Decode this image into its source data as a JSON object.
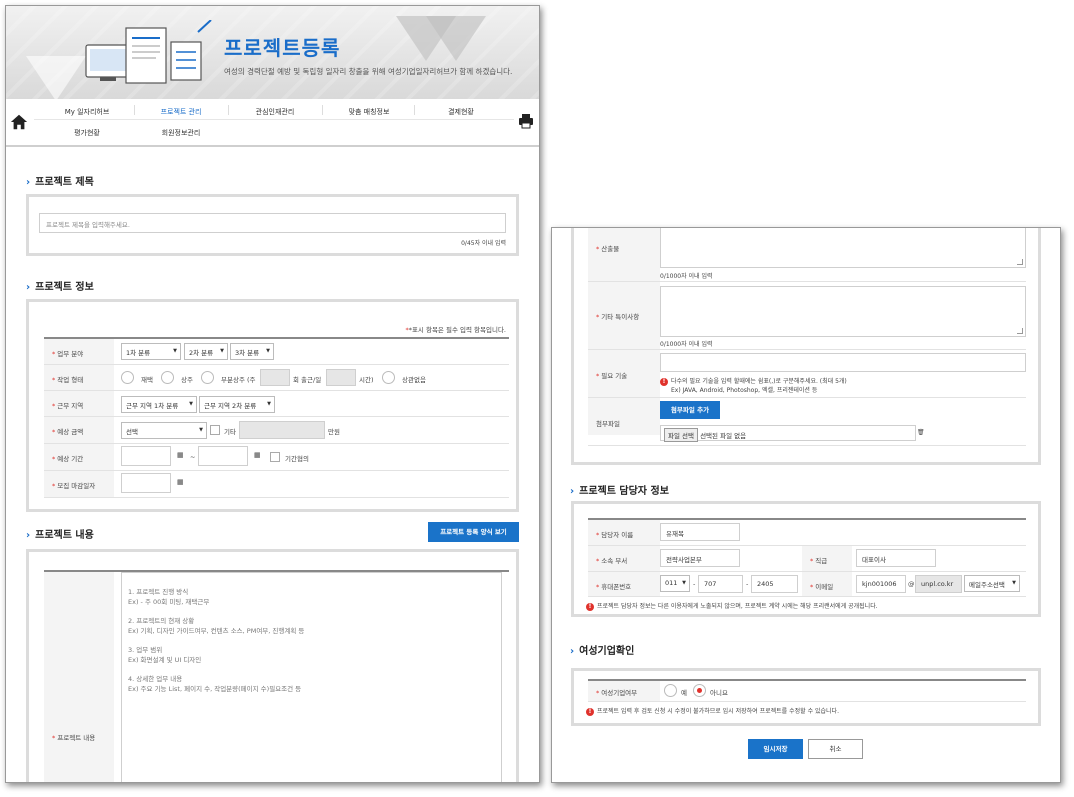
{
  "banner": {
    "title": "프로젝트등록",
    "subtitle": "여성의 경력단절 예방 및 독립형 일자리 창출을 위해 여성기업일자리허브가 함께 하겠습니다."
  },
  "nav": {
    "row1": [
      "My 일자리허브",
      "프로젝트 관리",
      "관심인재관리",
      "맞춤 매칭정보",
      "결제현황"
    ],
    "row2": [
      "평가현황",
      "회원정보관리"
    ],
    "active": "프로젝트 관리"
  },
  "title_section": {
    "heading": "프로젝트 제목",
    "placeholder": "프로젝트 제목을 입력해주세요.",
    "counter": "0/45자 이내 입력"
  },
  "info_section": {
    "heading": "프로젝트 정보",
    "required_note": "*표시 항목은 필수 입력 항목입니다.",
    "fields": {
      "category": {
        "label": "업무 분야",
        "sel1": "1차 분류",
        "sel2": "2차 분류",
        "sel3": "3차 분류"
      },
      "work_type": {
        "label": "작업 형태",
        "opt1": "재택",
        "opt2": "상주",
        "opt3": "부분상주 (주",
        "unit1": "회 출근/일",
        "unit2": "시간)",
        "opt4": "상관없음"
      },
      "region": {
        "label": "근무 지역",
        "sel1": "근무 지역 1차 분류",
        "sel2": "근무 지역 2차 분류"
      },
      "amount": {
        "label": "예상 금액",
        "sel": "선택",
        "etc": "기타",
        "unit": "만원"
      },
      "period": {
        "label": "예상 기간",
        "tilde": "~",
        "nego": "기간협의"
      },
      "deadline": {
        "label": "모집 마감일자"
      }
    }
  },
  "content_section": {
    "heading": "프로젝트 내용",
    "template_button": "프로젝트 등록 양식 보기",
    "label": "프로젝트 내용",
    "guide": [
      [
        "1. 프로젝트 진행 방식",
        "Ex) - 주 00회 미팅, 재택근무"
      ],
      [
        "2. 프로젝트의 현재 상황",
        "Ex) 기획, 디자인 가이드여부, 컨텐츠 소스, PM여부, 진행계획 등"
      ],
      [
        "3. 업무 범위",
        "Ex) 화면설계 및 UI 디자인"
      ],
      [
        "4. 상세한 업무 내용",
        "Ex) 주요 기능 List, 페이지 수, 작업분량(페이지 수)필요조건 등"
      ]
    ]
  },
  "right": {
    "deliverables": {
      "label": "산출물",
      "counter": "0/1000자 이내 입력"
    },
    "special": {
      "label": "기타 특이사항",
      "counter": "0/1000자 이내 입력"
    },
    "skills": {
      "label": "필요 기술",
      "note1": "다수의 필요 기술을 입력 할때에는 쉼표(,)로 구분해주세요. (최대 5개)",
      "note2": "Ex) JAVA, Android, Photoshop, 엑셀, 프리젠테이션 등"
    },
    "attach": {
      "label": "첨부파일",
      "add_button": "첨부파일 추가",
      "choose_button": "파일 선택",
      "no_file": "선택된 파일 없음"
    },
    "manager": {
      "heading": "프로젝트 담당자 정보",
      "name_label": "담당자 이름",
      "name_value": "유재복",
      "dept_label": "소속 부서",
      "dept_value": "전략사업본부",
      "title_label": "직급",
      "title_value": "대표이사",
      "phone_label": "휴대폰번호",
      "phone1": "011",
      "phone2": "707",
      "phone3": "2405",
      "email_label": "이메일",
      "email_id": "kjn001006",
      "at": "@",
      "email_domain": "unpl.co.kr",
      "email_select": "메일주소선택",
      "note": "프로젝트 담당자 정보는 다른 이용자에게 노출되지 않으며, 프로젝트 계약 시에는 해당 프리랜서에게 공개됩니다."
    },
    "women": {
      "heading": "여성기업확인",
      "label": "여성기업여부",
      "yes": "예",
      "no": "아니요",
      "note": "프로젝트 입력 후 검토 신청 시 수정이 불가하므로 임시 저장하여 프로젝트를 수정할 수 있습니다."
    },
    "buttons": {
      "save": "임시저장",
      "cancel": "취소"
    }
  }
}
